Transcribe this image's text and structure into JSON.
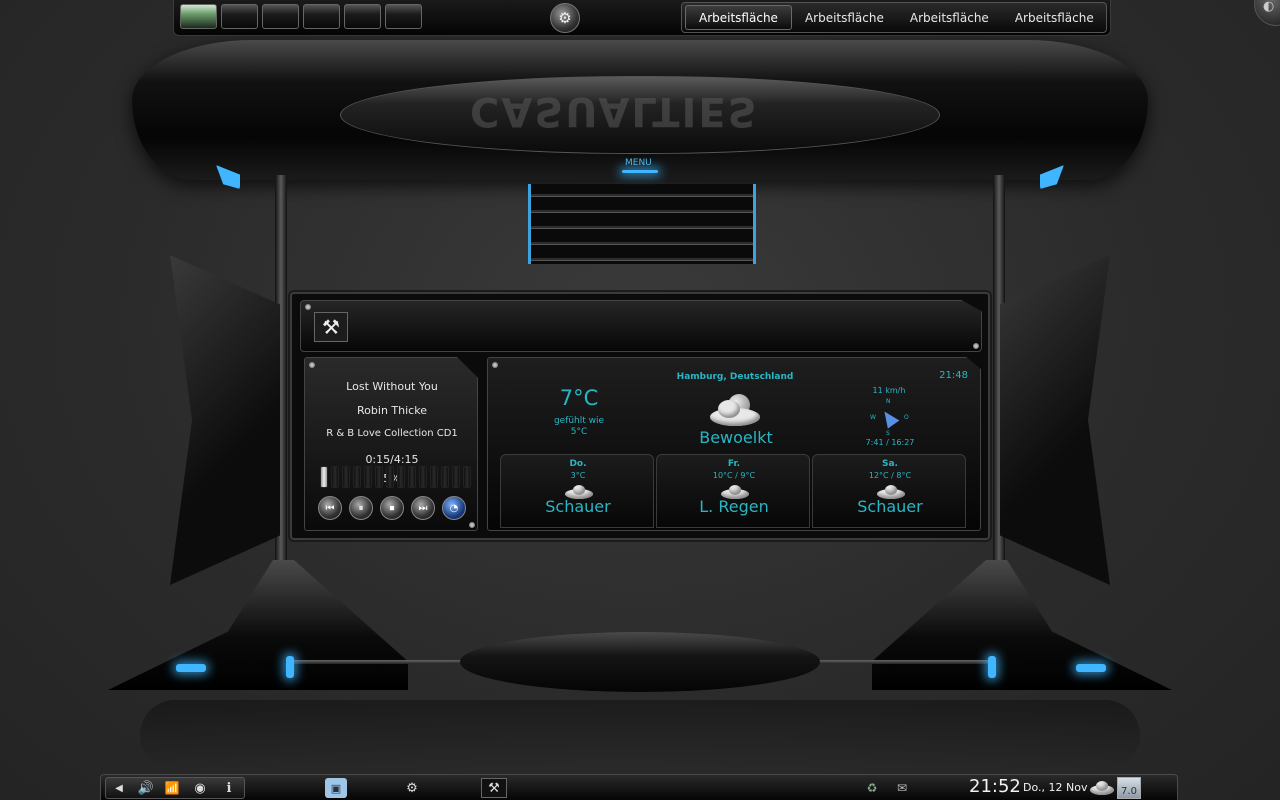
{
  "top_panel": {
    "pager_count": 6,
    "pager_active_index": 0,
    "kmenu_glyph": "⚙",
    "desktop_tabs": [
      "Arbeitsfläche",
      "Arbeitsfläche",
      "Arbeitsfläche",
      "Arbeitsfläche"
    ],
    "active_tab_index": 0,
    "cashew_glyph": "◐"
  },
  "theme": {
    "logo_text": "CASUALTIES",
    "menu_label": "MENU",
    "accent_blue": "#3fb6ff",
    "text_teal": "#29b6c4"
  },
  "toolbar": {
    "tools_icon": "⚒"
  },
  "player": {
    "title": "Lost Without You",
    "artist": "Robin Thicke",
    "album": "R & B Love Collection CD1",
    "time": "0:15/4:15",
    "percent_label": "5%",
    "progress": 0.05,
    "segments": 14,
    "controls": {
      "prev": "⏮",
      "pause": "⏸",
      "stop": "⏹",
      "next": "⏭",
      "open": "◔"
    }
  },
  "weather": {
    "location": "Hamburg, Deutschland",
    "time": "21:48",
    "temperature": "7°C",
    "feels_label": "gefühlt wie",
    "feels_value": "5°C",
    "condition": "Bewoelkt",
    "wind_speed": "11 km/h",
    "compass": {
      "n": "N",
      "w": "W",
      "o": "O",
      "s": "S"
    },
    "sun_times": "7:41 / 16:27",
    "forecast": [
      {
        "day": "Do.",
        "range": "3°C",
        "condition": "Schauer"
      },
      {
        "day": "Fr.",
        "range": "10°C / 9°C",
        "condition": "L. Regen"
      },
      {
        "day": "Sa.",
        "range": "12°C / 8°C",
        "condition": "Schauer"
      }
    ]
  },
  "taskbar": {
    "clock": "21:52",
    "date": "Do., 12 Nov",
    "temp_badge": "7.0",
    "icons": {
      "left_arrow": "◀",
      "volume": "🔊",
      "wifi": "📶",
      "network": "◉",
      "info": "i",
      "kmenu": "⚙",
      "tools": "⚒",
      "device": "♻",
      "mail": "✉"
    }
  }
}
